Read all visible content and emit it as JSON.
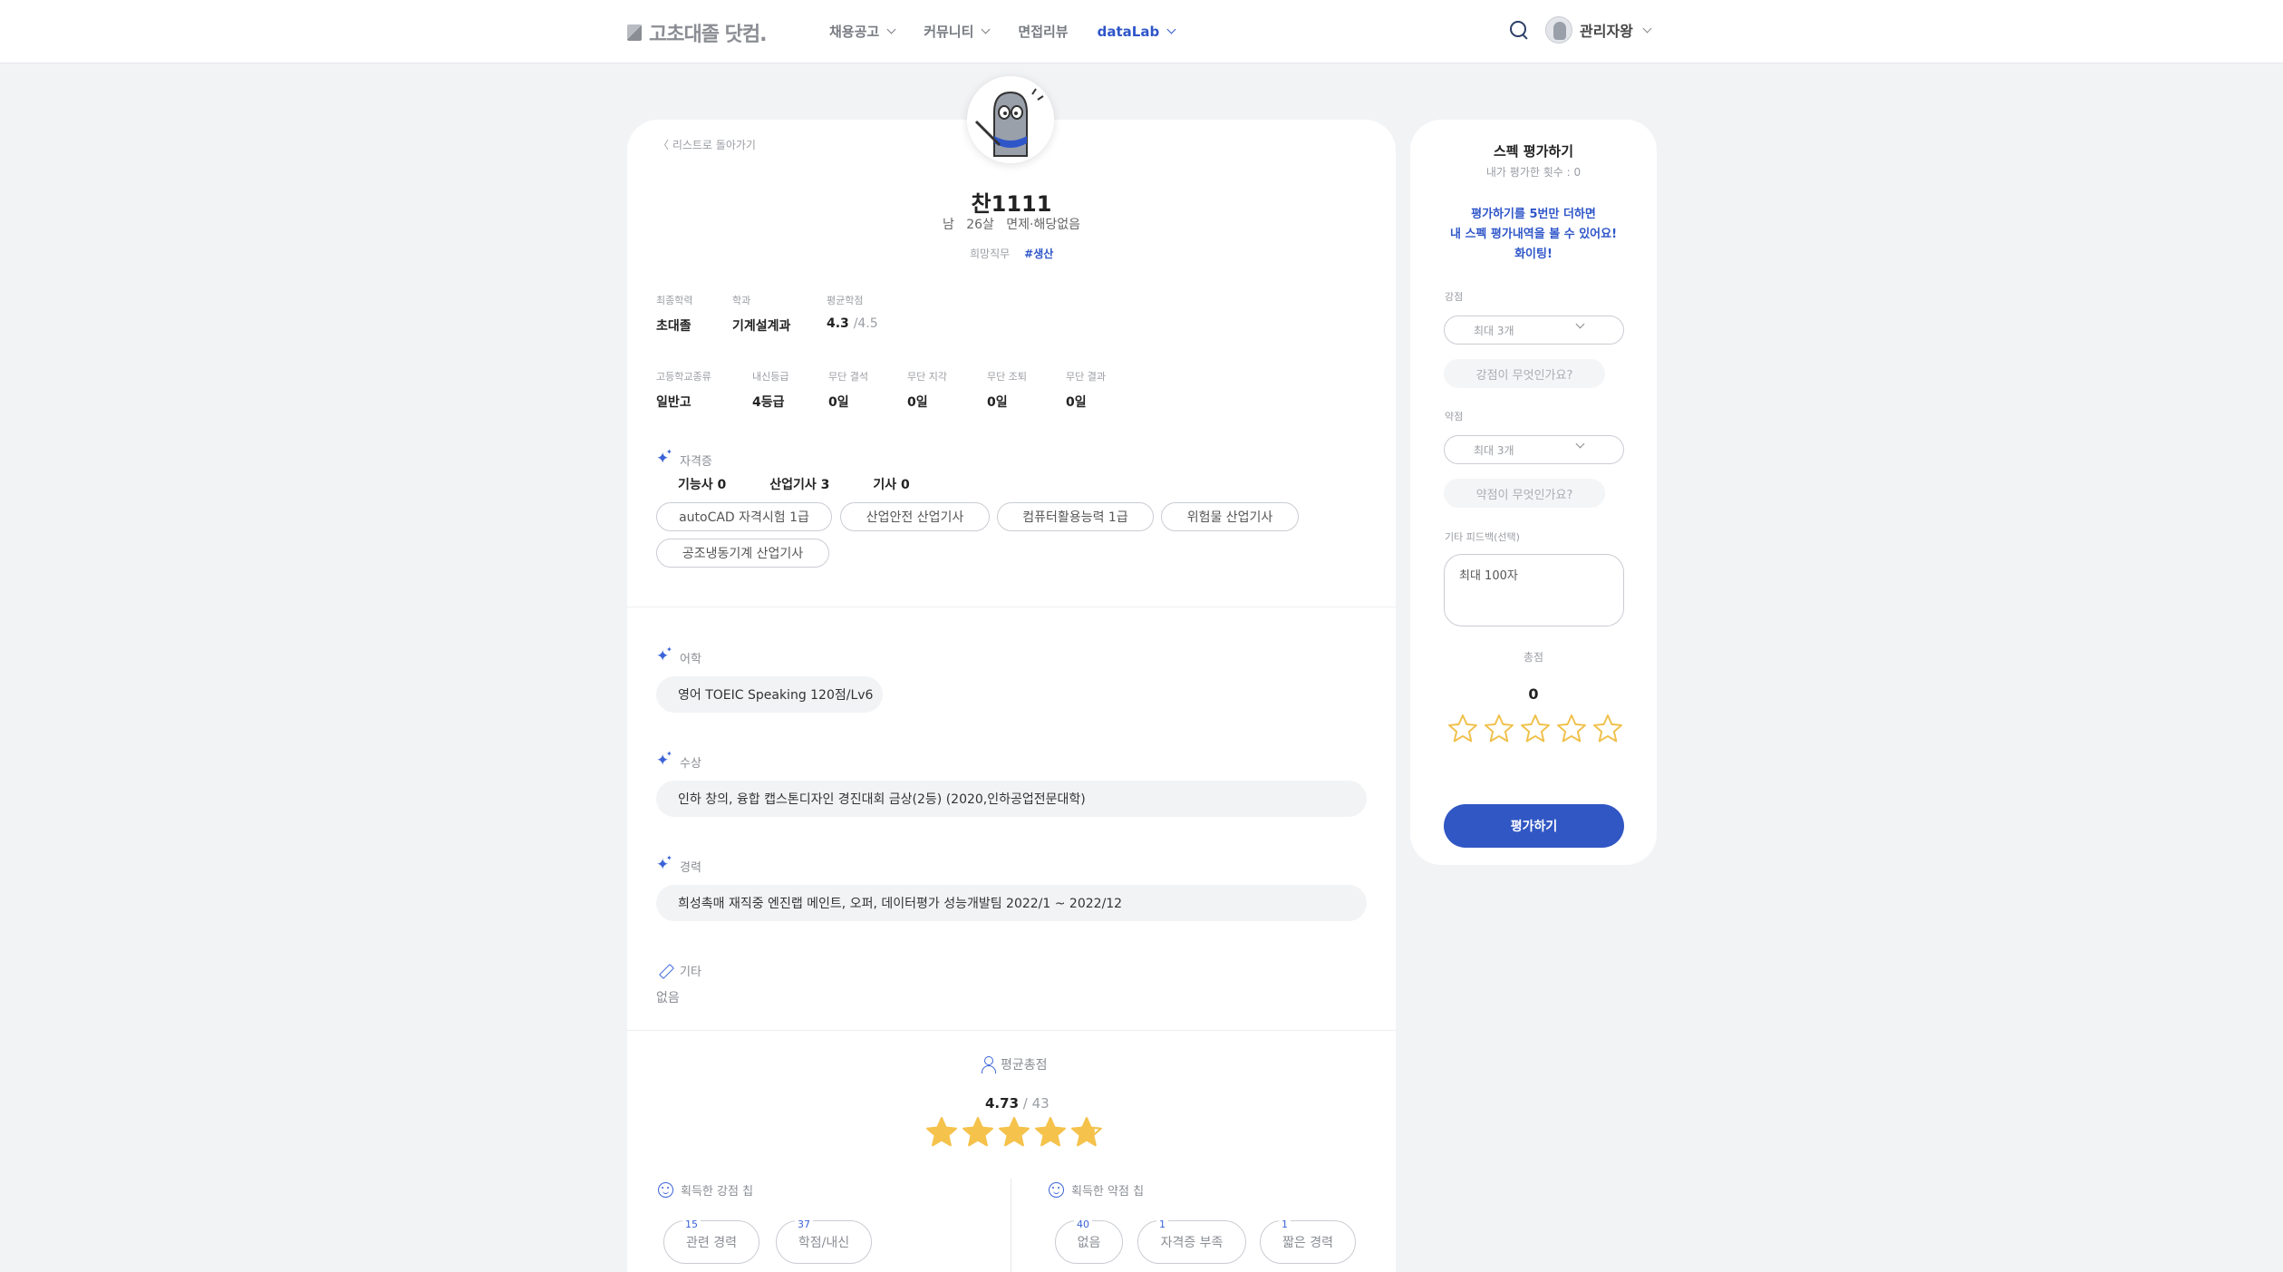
{
  "header": {
    "logo": "고초대졸 닷컴.",
    "nav": [
      {
        "label": "채용공고"
      },
      {
        "label": "커뮤니티"
      },
      {
        "label": "면접리뷰"
      },
      {
        "label": "dataLab"
      }
    ],
    "user_name": "관리자왕"
  },
  "profile": {
    "back_link": "〈  리스트로 돌아가기",
    "name": "찬1111",
    "gender": "남",
    "age": "26살",
    "military": "면제·해당없음",
    "job_label": "희망직무",
    "job_value": "#생산"
  },
  "education": [
    {
      "label": "최종학력",
      "value": "초대졸"
    },
    {
      "label": "학과",
      "value": "기계설계과"
    },
    {
      "label": "평균학점",
      "value": "4.3",
      "suffix": "/4.5"
    }
  ],
  "school": [
    {
      "label": "고등학교종류",
      "value": "일반고"
    },
    {
      "label": "내신등급",
      "value": "4등급"
    },
    {
      "label": "무단 결석",
      "value": "0일"
    },
    {
      "label": "무단 지각",
      "value": "0일"
    },
    {
      "label": "무단 조퇴",
      "value": "0일"
    },
    {
      "label": "무단 결과",
      "value": "0일"
    }
  ],
  "certificates": {
    "title": "자격증",
    "counts": [
      "기능사 0",
      "산업기사 3",
      "기사 0"
    ],
    "items": [
      "autoCAD 자격시험 1급",
      "산업안전 산업기사",
      "컴퓨터활용능력 1급",
      "위험물 산업기사",
      "공조냉동기계 산업기사"
    ]
  },
  "language": {
    "title": "어학",
    "value": "영어 TOEIC Speaking 120점/Lv6"
  },
  "awards": {
    "title": "수상",
    "value": "인하 창의, 융합 캡스톤디자인 경진대회 금상(2등) (2020,인하공업전문대학)"
  },
  "career": {
    "title": "경력",
    "value": "희성촉매 재직중 엔진랩 메인트, 오퍼, 데이터평가 성능개발팀 2022/1 ~ 2022/12"
  },
  "etc": {
    "title": "기타",
    "value": "없음"
  },
  "average": {
    "title": "평균총점",
    "score": "4.73",
    "count": "/ 43",
    "rating": 4.73
  },
  "strengths": {
    "title": "획득한 강점 칩",
    "tags": [
      {
        "count": "15",
        "label": "관련 경력"
      },
      {
        "count": "37",
        "label": "학점/내신"
      }
    ]
  },
  "weaknesses": {
    "title": "획득한 약점 칩",
    "tags": [
      {
        "count": "40",
        "label": "없음"
      },
      {
        "count": "1",
        "label": "자격증 부족"
      },
      {
        "count": "1",
        "label": "짧은 경력"
      }
    ]
  },
  "evaluate": {
    "title": "스펙 평가하기",
    "my_count": "내가 평가한 횟수 : 0",
    "message_lines": [
      "평가하기를 5번만 더하면",
      "내 스펙 평가내역을 볼 수 있어요!",
      "화이팅!"
    ],
    "strength_label": "강점",
    "strength_select": "최대 3개",
    "strength_question": "강점이 무엇인가요?",
    "weakness_label": "약점",
    "weakness_select": "최대 3개",
    "weakness_question": "약점이 무엇인가요?",
    "feedback_label": "기타 피드백(선택)",
    "feedback_placeholder": "최대 100자",
    "total_label": "총점",
    "total_value": "0",
    "rating": 0,
    "submit_label": "평가하기"
  },
  "colors": {
    "accent": "#3157c4",
    "star": "#f5c24c",
    "star_outline": "#f0c04a"
  },
  "icons": [
    "search-icon",
    "sparkle-icon",
    "pencil-icon",
    "person-icon",
    "smile-icon",
    "star-icon",
    "chevron-down-icon"
  ]
}
